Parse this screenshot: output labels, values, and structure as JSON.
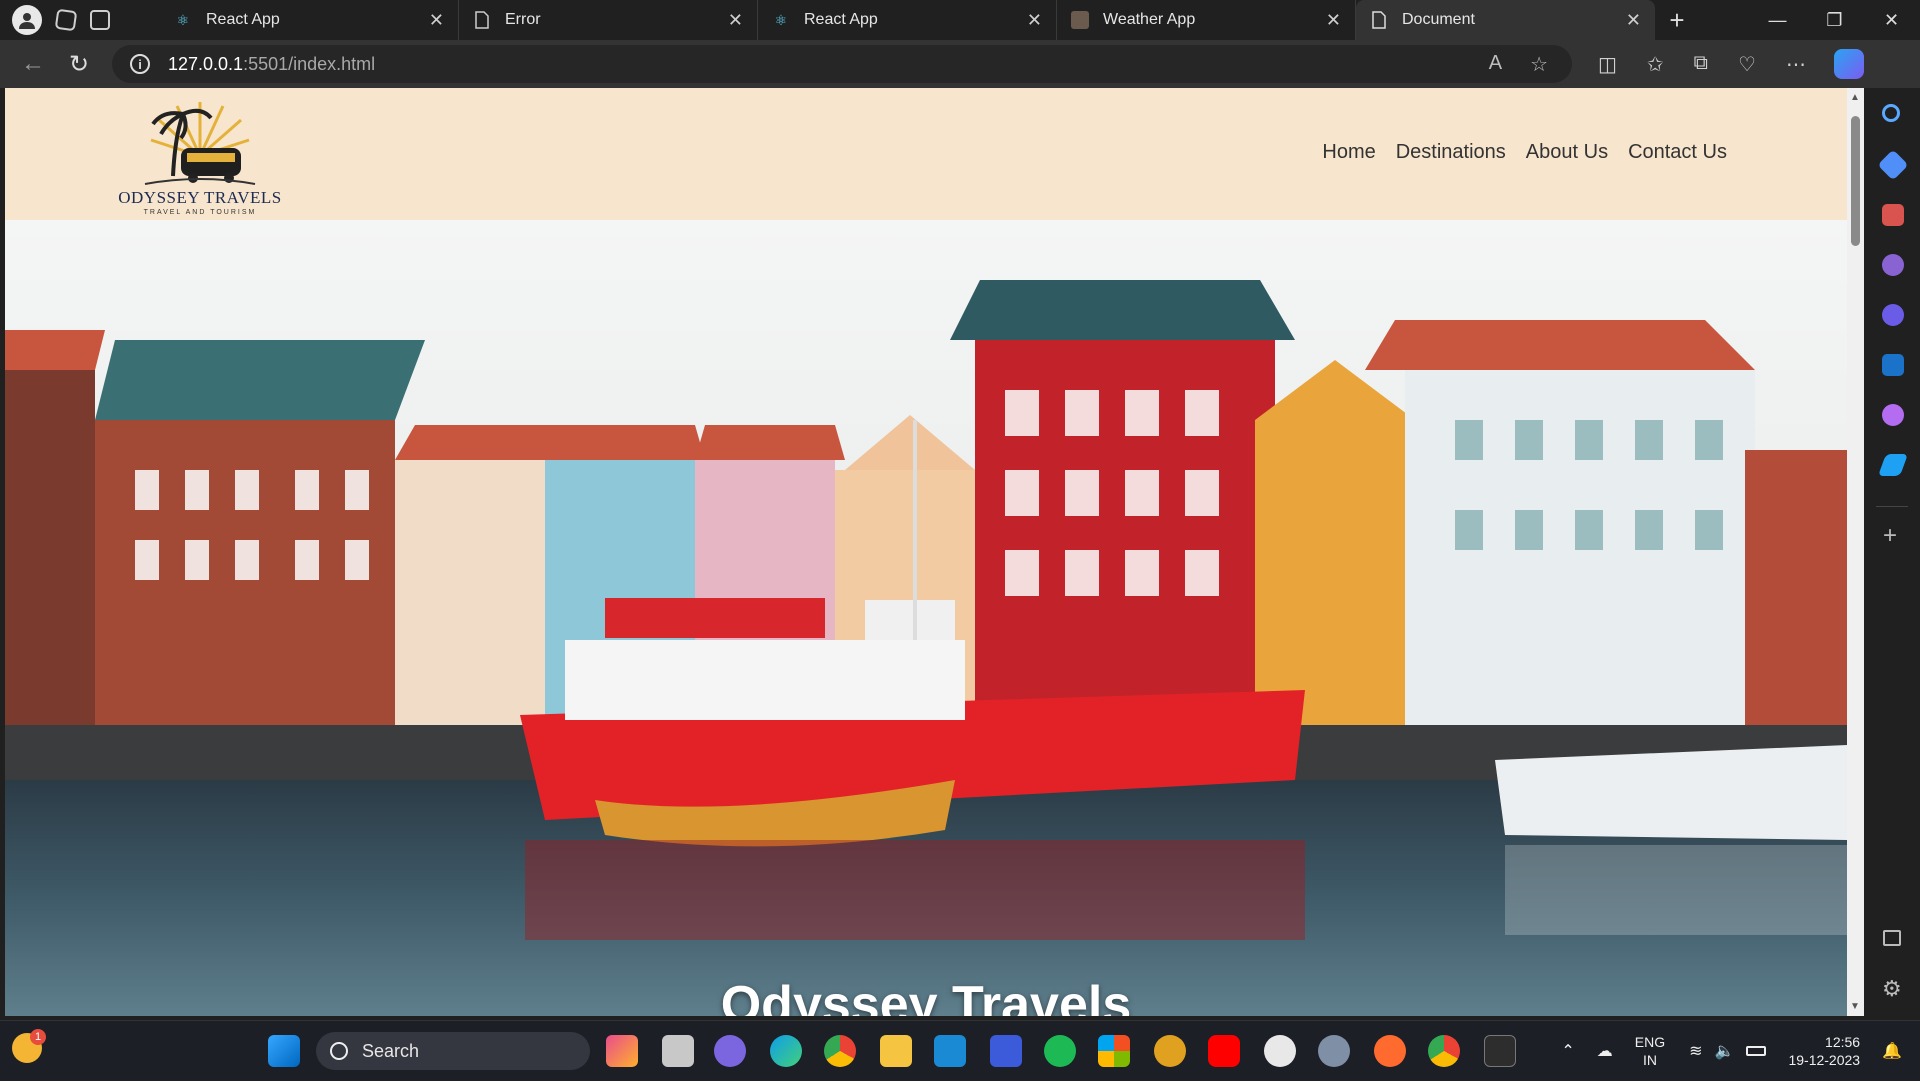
{
  "browser": {
    "tabs": [
      {
        "title": "React App",
        "icon": "react-icon",
        "active": false
      },
      {
        "title": "Error",
        "icon": "document-icon",
        "active": false
      },
      {
        "title": "React App",
        "icon": "react-icon",
        "active": false
      },
      {
        "title": "Weather App",
        "icon": "image-icon",
        "active": false
      },
      {
        "title": "Document",
        "icon": "document-icon",
        "active": true
      }
    ],
    "close_glyph": "✕",
    "new_tab_glyph": "+",
    "url_host": "127.0.0.1",
    "url_path": ":5501/index.html"
  },
  "site": {
    "logo_title": "ODYSSEY TRAVELS",
    "logo_subtitle": "TRAVEL AND TOURISM",
    "nav": [
      "Home",
      "Destinations",
      "About Us",
      "Contact Us"
    ],
    "hero_title": "Odyssey Travels"
  },
  "taskbar": {
    "search_label": "Search",
    "lang_line1": "ENG",
    "lang_line2": "IN",
    "time": "12:56",
    "date": "19-12-2023",
    "notification_count": "1"
  },
  "colors": {
    "header_bg": "#f7e6cd",
    "logo_navy": "#1d2a52"
  }
}
